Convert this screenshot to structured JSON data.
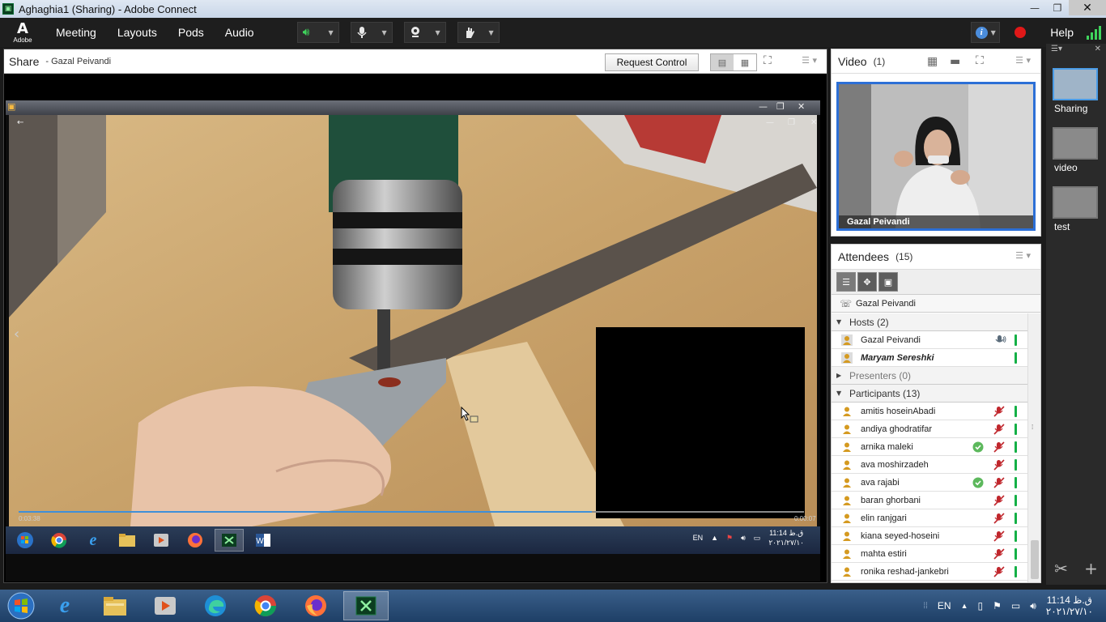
{
  "window": {
    "title": "Aghaghia1 (Sharing) - Adobe Connect",
    "min": "—",
    "max": "❐",
    "close": "✕"
  },
  "menubar": {
    "logo_text": "Adobe",
    "items": [
      "Meeting",
      "Layouts",
      "Pods",
      "Audio"
    ],
    "help": "Help"
  },
  "share_pod": {
    "title": "Share",
    "presenter": "- Gazal Peivandi",
    "request_control": "Request Control"
  },
  "player": {
    "time_current": "0:03:38",
    "time_total": "0:00:07",
    "progress": 0.73
  },
  "inner_taskbar": {
    "lang": "EN",
    "time": "11:14 ق.ظ",
    "date": "۲۰۲۱/۲۷/۱۰"
  },
  "video_pod": {
    "title": "Video",
    "count": "(1)",
    "speaker_name": "Gazal Peivandi"
  },
  "attendees": {
    "title": "Attendees",
    "count": "(15)",
    "me": "Gazal Peivandi",
    "groups": {
      "hosts": "Hosts (2)",
      "presenters": "Presenters (0)",
      "participants": "Participants (13)"
    },
    "hosts": [
      {
        "name": "Gazal Peivandi"
      },
      {
        "name": "Maryam Sereshki"
      }
    ],
    "participants": [
      {
        "name": "amitis hoseinAbadi"
      },
      {
        "name": "andiya ghodratifar"
      },
      {
        "name": "arnika maleki"
      },
      {
        "name": "ava moshirzadeh"
      },
      {
        "name": "ava rajabi"
      },
      {
        "name": "baran ghorbani"
      },
      {
        "name": "elin ranjgari"
      },
      {
        "name": "kiana seyed-hoseini"
      },
      {
        "name": "mahta estiri"
      },
      {
        "name": "ronika reshad-jankebri"
      }
    ]
  },
  "layouts": {
    "items": [
      "Sharing",
      "video",
      "test"
    ]
  },
  "taskbar": {
    "lang": "EN",
    "time": "11:14 ق.ظ",
    "date": "۲۰۲۱/۲۷/۱۰"
  },
  "colors": {
    "accent": "#2c6fd6",
    "status_green": "#14b046",
    "record": "#e01818",
    "mic_muted": "#c0272d"
  }
}
